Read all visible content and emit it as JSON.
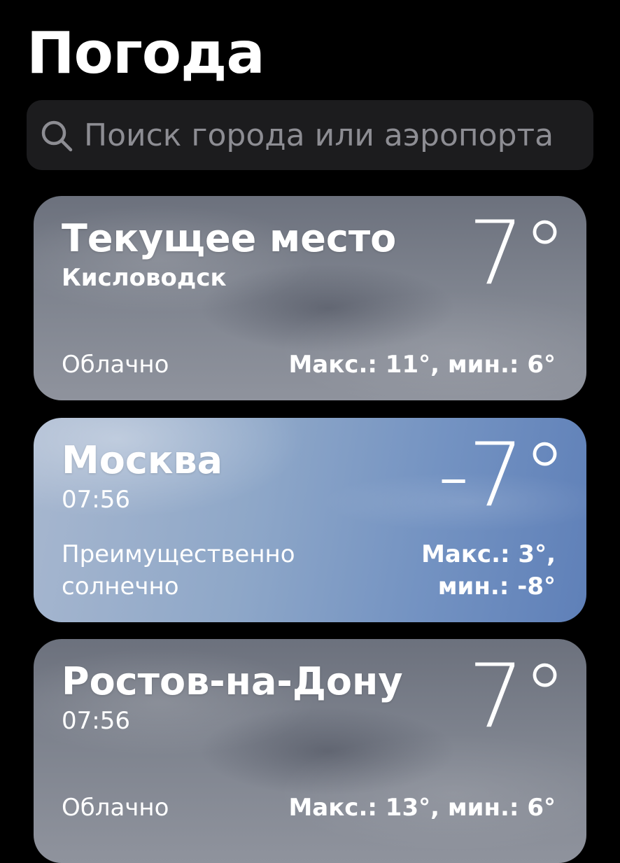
{
  "header": {
    "title": "Погода"
  },
  "search": {
    "placeholder": "Поиск города или аэропорта",
    "icon": "search-icon"
  },
  "locations": [
    {
      "name": "Текущее место",
      "subtitle": "Кисловодск",
      "temperature": "7°",
      "condition": "Облачно",
      "high_low": "Макс.: 11°, мин.: 6°",
      "theme": "cloudy"
    },
    {
      "name": "Москва",
      "subtitle": "07:56",
      "temperature": "-7°",
      "condition": "Преимущественно солнечно",
      "high_low": "Макс.: 3°, мин.: -8°",
      "theme": "sunny"
    },
    {
      "name": "Ростов-на-Дону",
      "subtitle": "07:56",
      "temperature": "7°",
      "condition": "Облачно",
      "high_low": "Макс.: 13°, мин.: 6°",
      "theme": "cloudy"
    }
  ],
  "colors": {
    "background": "#000000",
    "search_field": "#1c1c1e",
    "placeholder": "#8d8d93",
    "cloudy_card": "#7e838e",
    "sunny_card": "#7493c2"
  }
}
